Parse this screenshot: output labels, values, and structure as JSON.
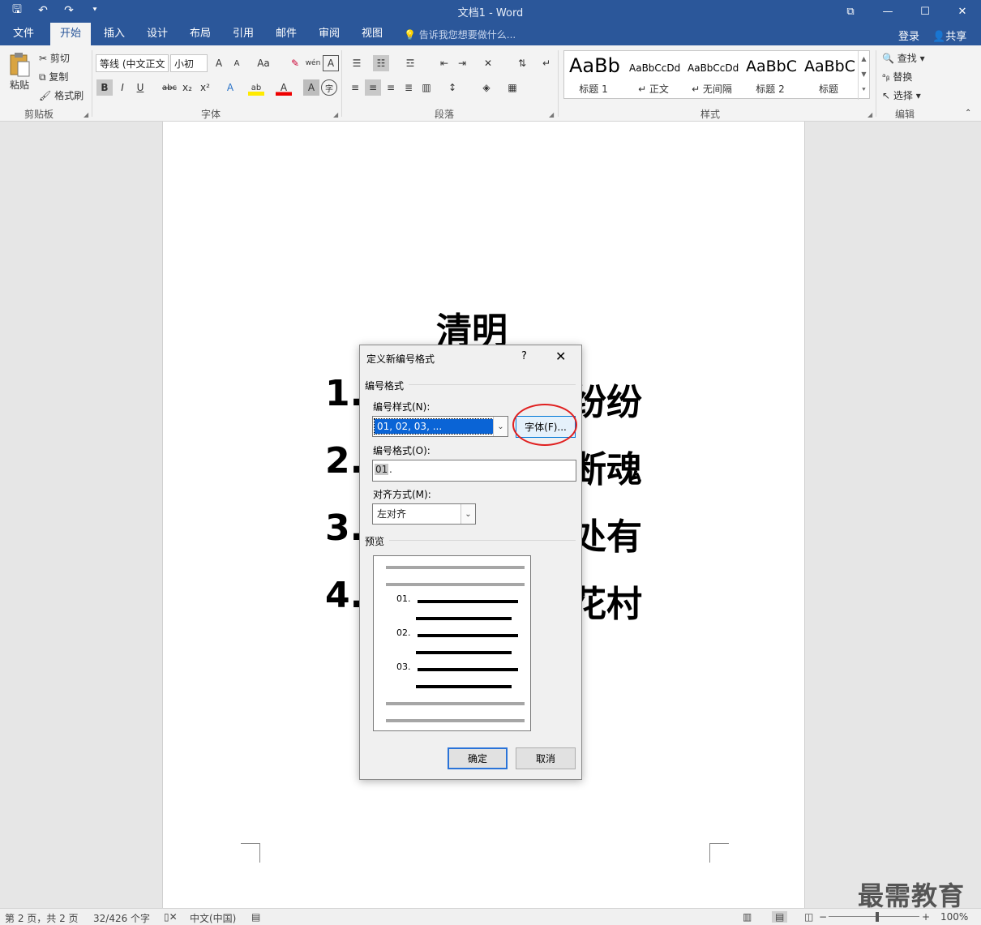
{
  "window": {
    "title": "文档1 - Word",
    "qat_save": "🖫",
    "qat_undo": "↶",
    "qat_redo": "↷",
    "qat_more": "⯆",
    "ribbon_display": "⧉",
    "minimize": "—",
    "maximize": "☐",
    "close": "✕"
  },
  "tabs": [
    {
      "label": "文件"
    },
    {
      "label": "开始"
    },
    {
      "label": "插入"
    },
    {
      "label": "设计"
    },
    {
      "label": "布局"
    },
    {
      "label": "引用"
    },
    {
      "label": "邮件"
    },
    {
      "label": "审阅"
    },
    {
      "label": "视图"
    }
  ],
  "tell_me": "告诉我您想要做什么...",
  "login": "登录",
  "share": "共享",
  "ribbon": {
    "clipboard": {
      "paste": "粘贴",
      "cut": "剪切",
      "copy": "复制",
      "format_painter": "格式刷",
      "label": "剪贴板"
    },
    "font": {
      "font_name": "等线 (中文正文",
      "font_size": "小初",
      "grow": "A",
      "shrink": "A",
      "change_case": "Aa",
      "clear": "✎",
      "phonetic": "wén",
      "charborder": "A",
      "bold": "B",
      "italic": "I",
      "underline": "U",
      "strike": "abc",
      "subscript": "x₂",
      "superscript": "x²",
      "effects": "A",
      "highlight": "ab",
      "font_color": "A",
      "shading": "A",
      "enclose": "字",
      "label": "字体"
    },
    "paragraph": {
      "label": "段落"
    },
    "styles": {
      "items": [
        {
          "sample": "AaBb",
          "name": "标题 1"
        },
        {
          "sample": "AaBbCcDd",
          "name": "↵ 正文"
        },
        {
          "sample": "AaBbCcDd",
          "name": "↵ 无间隔"
        },
        {
          "sample": "AaBbC",
          "name": "标题 2"
        },
        {
          "sample": "AaBbC",
          "name": "标题"
        }
      ],
      "label": "样式"
    },
    "editing": {
      "find": "查找",
      "replace": "替换",
      "select": "选择",
      "label": "编辑"
    }
  },
  "document": {
    "heading": "清明",
    "items": [
      {
        "num": "1.",
        "tail": "纷纷"
      },
      {
        "num": "2.",
        "tail": "断魂"
      },
      {
        "num": "3.",
        "tail": "处有"
      },
      {
        "num": "4.",
        "tail": "花村"
      }
    ]
  },
  "dialog": {
    "title": "定义新编号格式",
    "help": "?",
    "close": "✕",
    "section_number_format": "编号格式",
    "number_style_label": "编号样式(N):",
    "number_style_value": "01, 02, 03, ...",
    "font_button": "字体(F)...",
    "number_format_label": "编号格式(O):",
    "number_format_value": "01",
    "number_format_suffix": ".",
    "alignment_label": "对齐方式(M):",
    "alignment_value": "左对齐",
    "section_preview": "预览",
    "preview_numbers": [
      "01.",
      "02.",
      "03."
    ],
    "ok": "确定",
    "cancel": "取消"
  },
  "statusbar": {
    "page": "第 2 页，共 2 页",
    "words": "32/426 个字",
    "language": "中文(中国)",
    "zoom": "100%"
  },
  "watermark": "最需教育",
  "colors": {
    "accent": "#2b579a",
    "highlight_red": "#e02020",
    "selection_blue": "#0a64d6"
  }
}
